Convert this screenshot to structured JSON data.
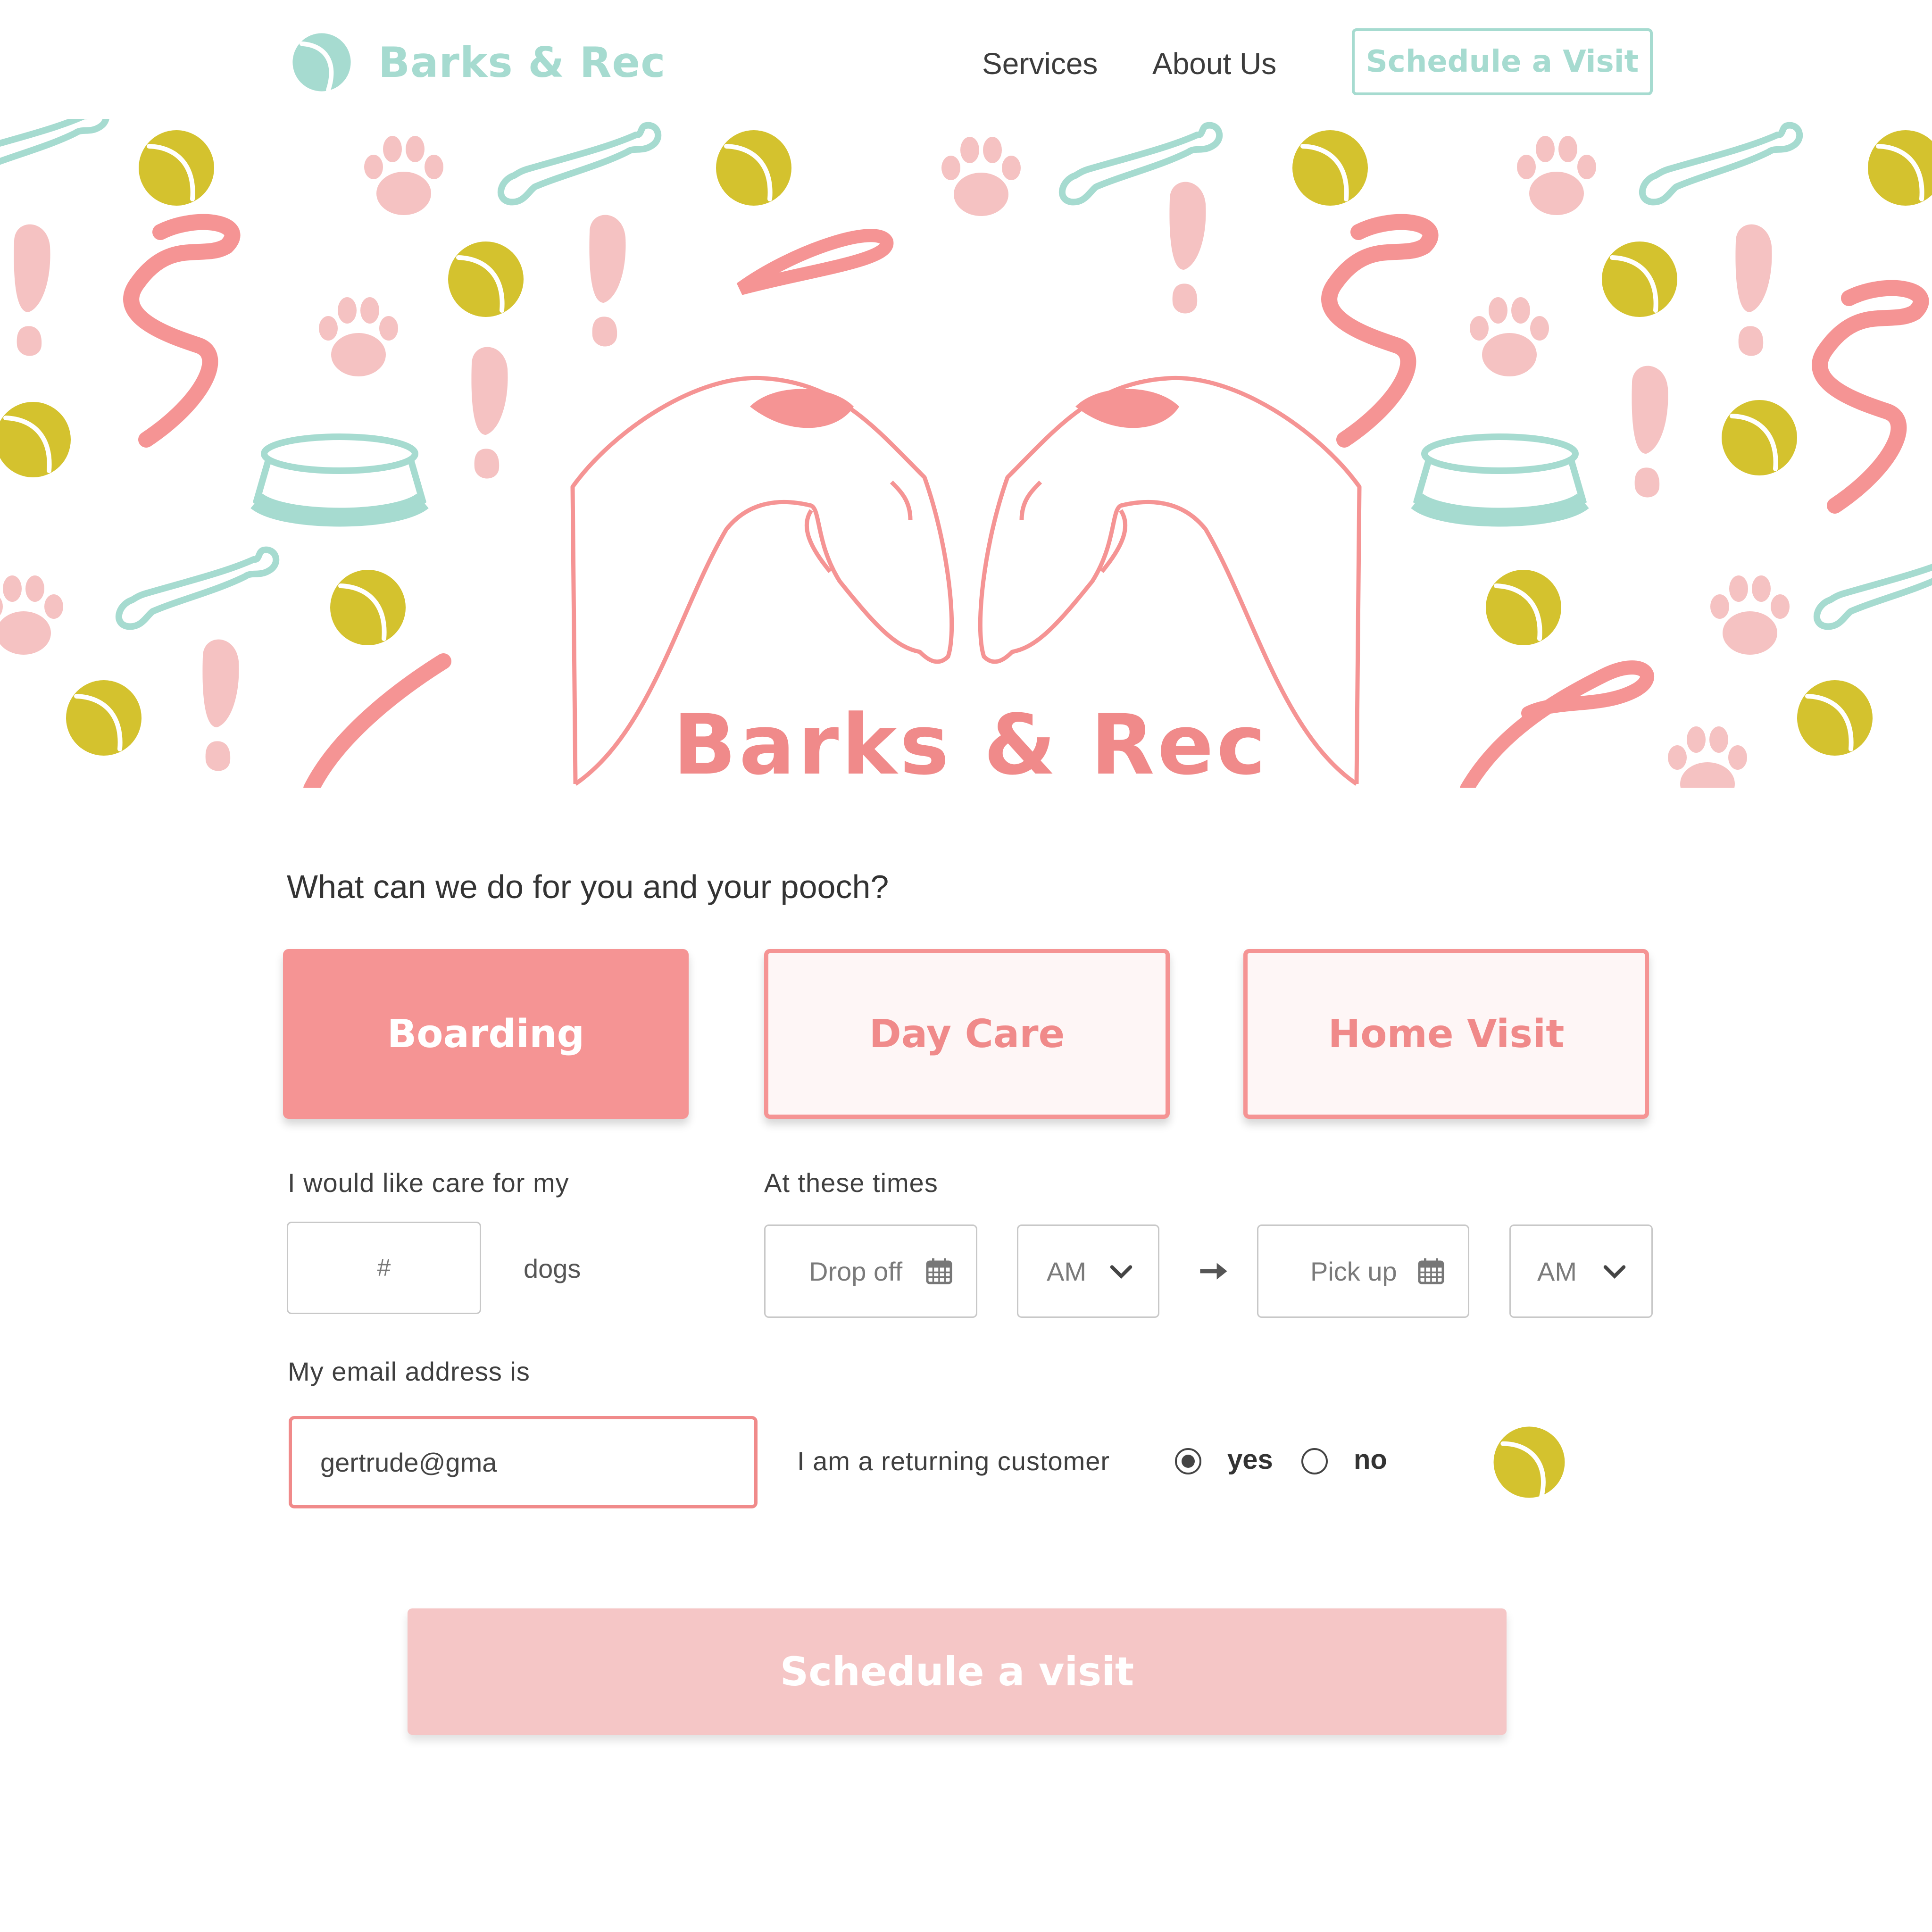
{
  "header": {
    "brand": "Barks & Rec",
    "nav": {
      "services": "Services",
      "about": "About Us",
      "cta": "Schedule a Visit"
    }
  },
  "hero": {
    "title": "Barks & Rec"
  },
  "form": {
    "question": "What can we do for you and your pooch?",
    "services": [
      {
        "label": "Boarding",
        "selected": true
      },
      {
        "label": "Day Care",
        "selected": false
      },
      {
        "label": "Home Visit",
        "selected": false
      }
    ],
    "care_label": "I would like care for my",
    "dogs_placeholder": "#",
    "dogs_suffix": "dogs",
    "times_label": "At these times",
    "dropoff_placeholder": "Drop off",
    "dropoff_ampm": "AM",
    "pickup_placeholder": "Pick up",
    "pickup_ampm": "AM",
    "email_label": "My email address is",
    "email_value": "gertrude@gma",
    "returning_label": "I am a returning customer",
    "returning_options": [
      "yes",
      "no"
    ],
    "returning_selected": "yes",
    "submit": "Schedule a visit"
  },
  "icons": {
    "logo": "tennis-ball-icon",
    "calendar": "calendar-icon",
    "chevron": "chevron-down-icon",
    "arrow": "arrow-right-icon",
    "decor": "tennis-ball-icon"
  },
  "colors": {
    "pink": "#f59494",
    "pink_light": "#f5c6c6",
    "mint": "#a6dbd0",
    "ball": "#d4c22e",
    "paw": "#f5c2c2"
  }
}
